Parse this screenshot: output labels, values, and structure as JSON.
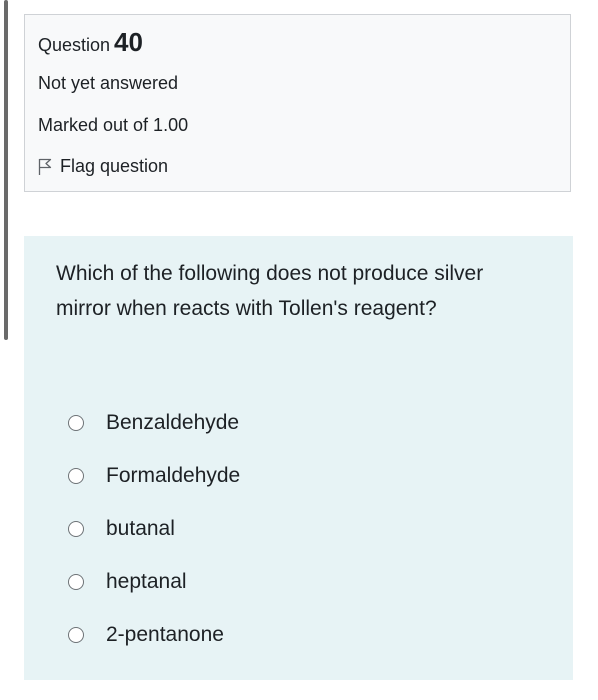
{
  "info": {
    "question_word": "Question",
    "question_number": "40",
    "state": "Not yet answered",
    "grade": "Marked out of 1.00",
    "flag_label": "Flag question",
    "flag_icon": "flag-outline-icon"
  },
  "question": {
    "text": "Which of the following does not produce silver mirror when reacts with Tollen's reagent?",
    "options": [
      {
        "label": "Benzaldehyde",
        "selected": false
      },
      {
        "label": "Formaldehyde",
        "selected": false
      },
      {
        "label": "butanal",
        "selected": false
      },
      {
        "label": "heptanal",
        "selected": false
      },
      {
        "label": "2-pentanone",
        "selected": false
      }
    ]
  },
  "colors": {
    "info_background": "#f8f9fa",
    "content_background": "#e7f3f5",
    "text": "#1d2125"
  }
}
